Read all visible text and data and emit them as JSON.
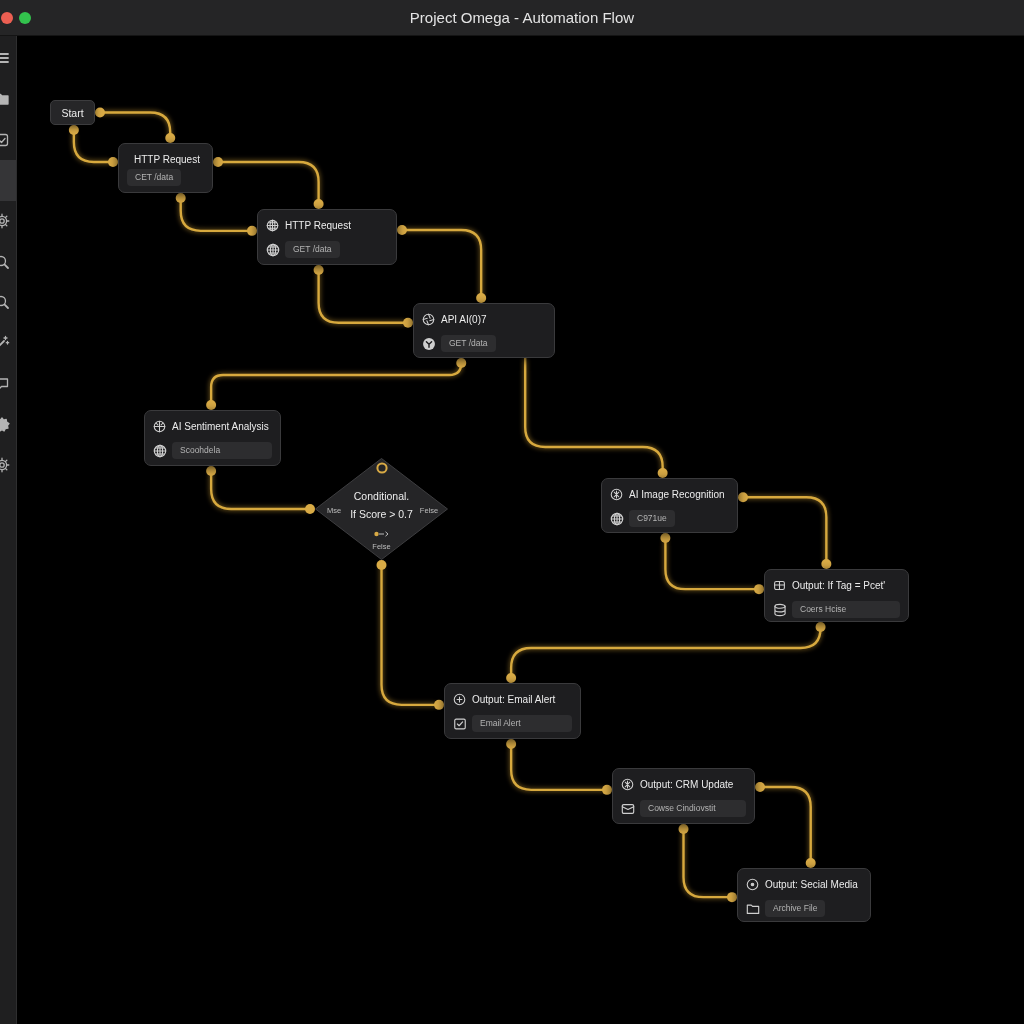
{
  "window": {
    "title": "Project Omega - Automation Flow"
  },
  "sidebar": {
    "items": [
      {
        "selected": false
      },
      {
        "selected": false
      },
      {
        "selected": false
      },
      {
        "selected": true
      },
      {
        "selected": false
      },
      {
        "selected": false
      },
      {
        "selected": false
      },
      {
        "selected": false
      },
      {
        "selected": false
      },
      {
        "selected": false
      },
      {
        "selected": false
      }
    ]
  },
  "canvas": {
    "nodes": [
      {
        "kind": "start",
        "title": "Start"
      },
      {
        "kind": "card",
        "title": "HTTP Request",
        "value": "CET /data"
      },
      {
        "kind": "card",
        "title": "HTTP Request",
        "value": "GET /data"
      },
      {
        "kind": "card",
        "title": "API AI(0)7",
        "value": "GET /data"
      },
      {
        "kind": "card",
        "title": "AI Sentiment Analysis",
        "value": "Scoohdela"
      },
      {
        "kind": "decision",
        "title": "Conditional.",
        "condition": "If Score > 0.7",
        "left_label": "Mse",
        "right_label": "Felse",
        "bottom_label": "Felse"
      },
      {
        "kind": "card",
        "title": "AI Image Recognition",
        "value": "C971ue"
      },
      {
        "kind": "card",
        "title": "Output: If Tag = Pcet'",
        "value": "Coers Hcise"
      },
      {
        "kind": "card",
        "title": "Output: Email Alert",
        "value": "Email Alert"
      },
      {
        "kind": "card",
        "title": "Output: CRM Update",
        "value": "Cowse Cindiovstit"
      },
      {
        "kind": "card",
        "title": "Output: Secial Media",
        "value": "Archive File"
      }
    ]
  }
}
